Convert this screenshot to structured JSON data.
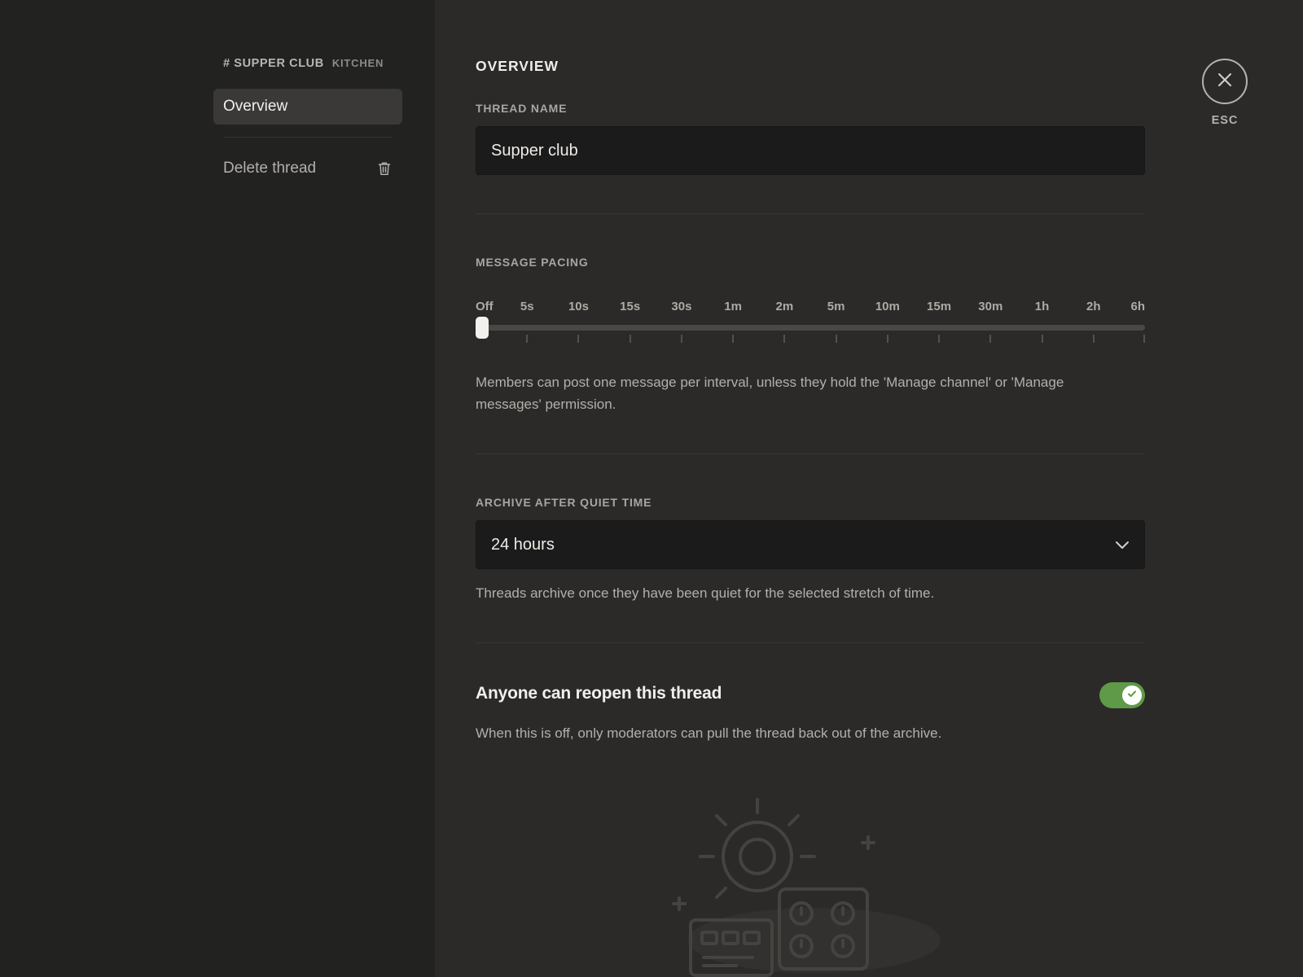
{
  "sidebar": {
    "channel_name": "# SUPPER CLUB",
    "category_name": "KITCHEN",
    "items": [
      {
        "label": "Overview",
        "selected": true
      }
    ],
    "delete_label": "Delete thread",
    "delete_icon": "trash-icon"
  },
  "main": {
    "title": "OVERVIEW",
    "thread_name": {
      "label": "THREAD NAME",
      "value": "Supper club"
    },
    "message_pacing": {
      "label": "MESSAGE PACING",
      "steps": [
        "Off",
        "5s",
        "10s",
        "15s",
        "30s",
        "1m",
        "2m",
        "5m",
        "10m",
        "15m",
        "30m",
        "1h",
        "2h",
        "6h"
      ],
      "selected": "Off",
      "help": "Members can post one message per interval, unless they hold the 'Manage channel' or 'Manage messages' permission."
    },
    "archive": {
      "label": "ARCHIVE AFTER QUIET TIME",
      "selected": "24 hours",
      "help": "Threads archive once they have been quiet for the selected stretch of time.",
      "icon": "chevron-down-icon"
    },
    "reopen": {
      "title": "Anyone can reopen this thread",
      "enabled": true,
      "help": "When this is off, only moderators can pull the thread back out of the archive."
    }
  },
  "close": {
    "label": "ESC",
    "icon": "close-icon"
  },
  "colors": {
    "sidebar_bg": "#222221",
    "main_bg": "#2b2a29",
    "toggle_on": "#5f9a48"
  }
}
